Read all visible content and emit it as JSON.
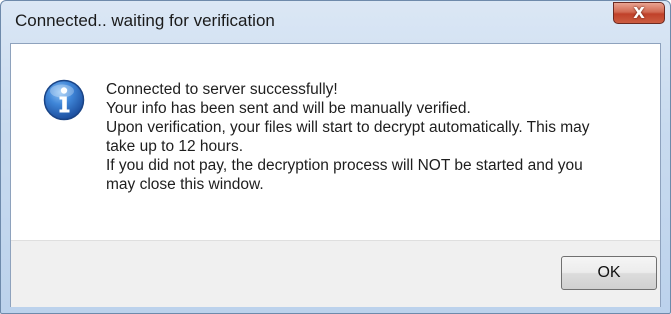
{
  "window": {
    "title": "Connected.. waiting for verification",
    "close_glyph": "X"
  },
  "dialog": {
    "icon": "info-icon",
    "message_lines": [
      "Connected to server successfully!",
      "Your info has been sent and will be manually verified.",
      "Upon verification, your files will start to decrypt automatically. This may",
      "take up to 12 hours.",
      "If you did not pay, the decryption process will NOT be started and you",
      "may close this window."
    ],
    "ok_label": "OK"
  },
  "colors": {
    "titlebar": "#c9dbef",
    "close_button": "#c0412a",
    "info_icon": "#2a63b8",
    "button_area": "#f0f0f0"
  }
}
